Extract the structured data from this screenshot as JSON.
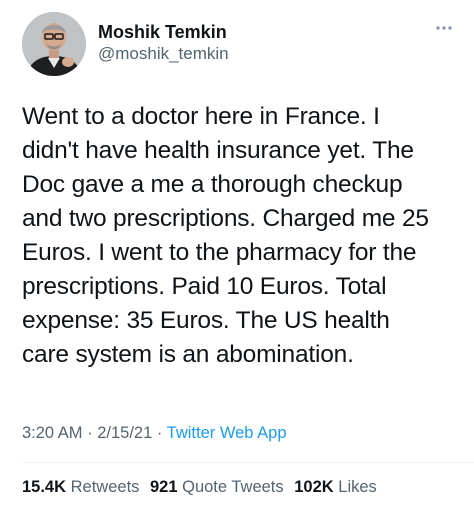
{
  "author": {
    "name": "Moshik Temkin",
    "handle": "@moshik_temkin",
    "avatar": "profile-photo"
  },
  "tweet": {
    "text": "Went to a doctor here in France. I\ndidn't have health insurance yet. The\nDoc gave a me a thorough checkup\nand two prescriptions. Charged me 25\nEuros. I went to the pharmacy for the\nprescriptions. Paid 10 Euros. Total\nexpense: 35 Euros. The US health\ncare system is an abomination.",
    "time": "3:20 AM",
    "date": "2/15/21",
    "source": "Twitter Web App"
  },
  "stats": {
    "retweets_count": "15.4K",
    "retweets_label": "Retweets",
    "quotes_count": "921",
    "quotes_label": "Quote Tweets",
    "likes_count": "102K",
    "likes_label": "Likes"
  },
  "icons": {
    "more": "more-options-icon"
  },
  "colors": {
    "text_primary": "#0f1419",
    "text_secondary": "#536471",
    "link": "#1d9bf0"
  }
}
